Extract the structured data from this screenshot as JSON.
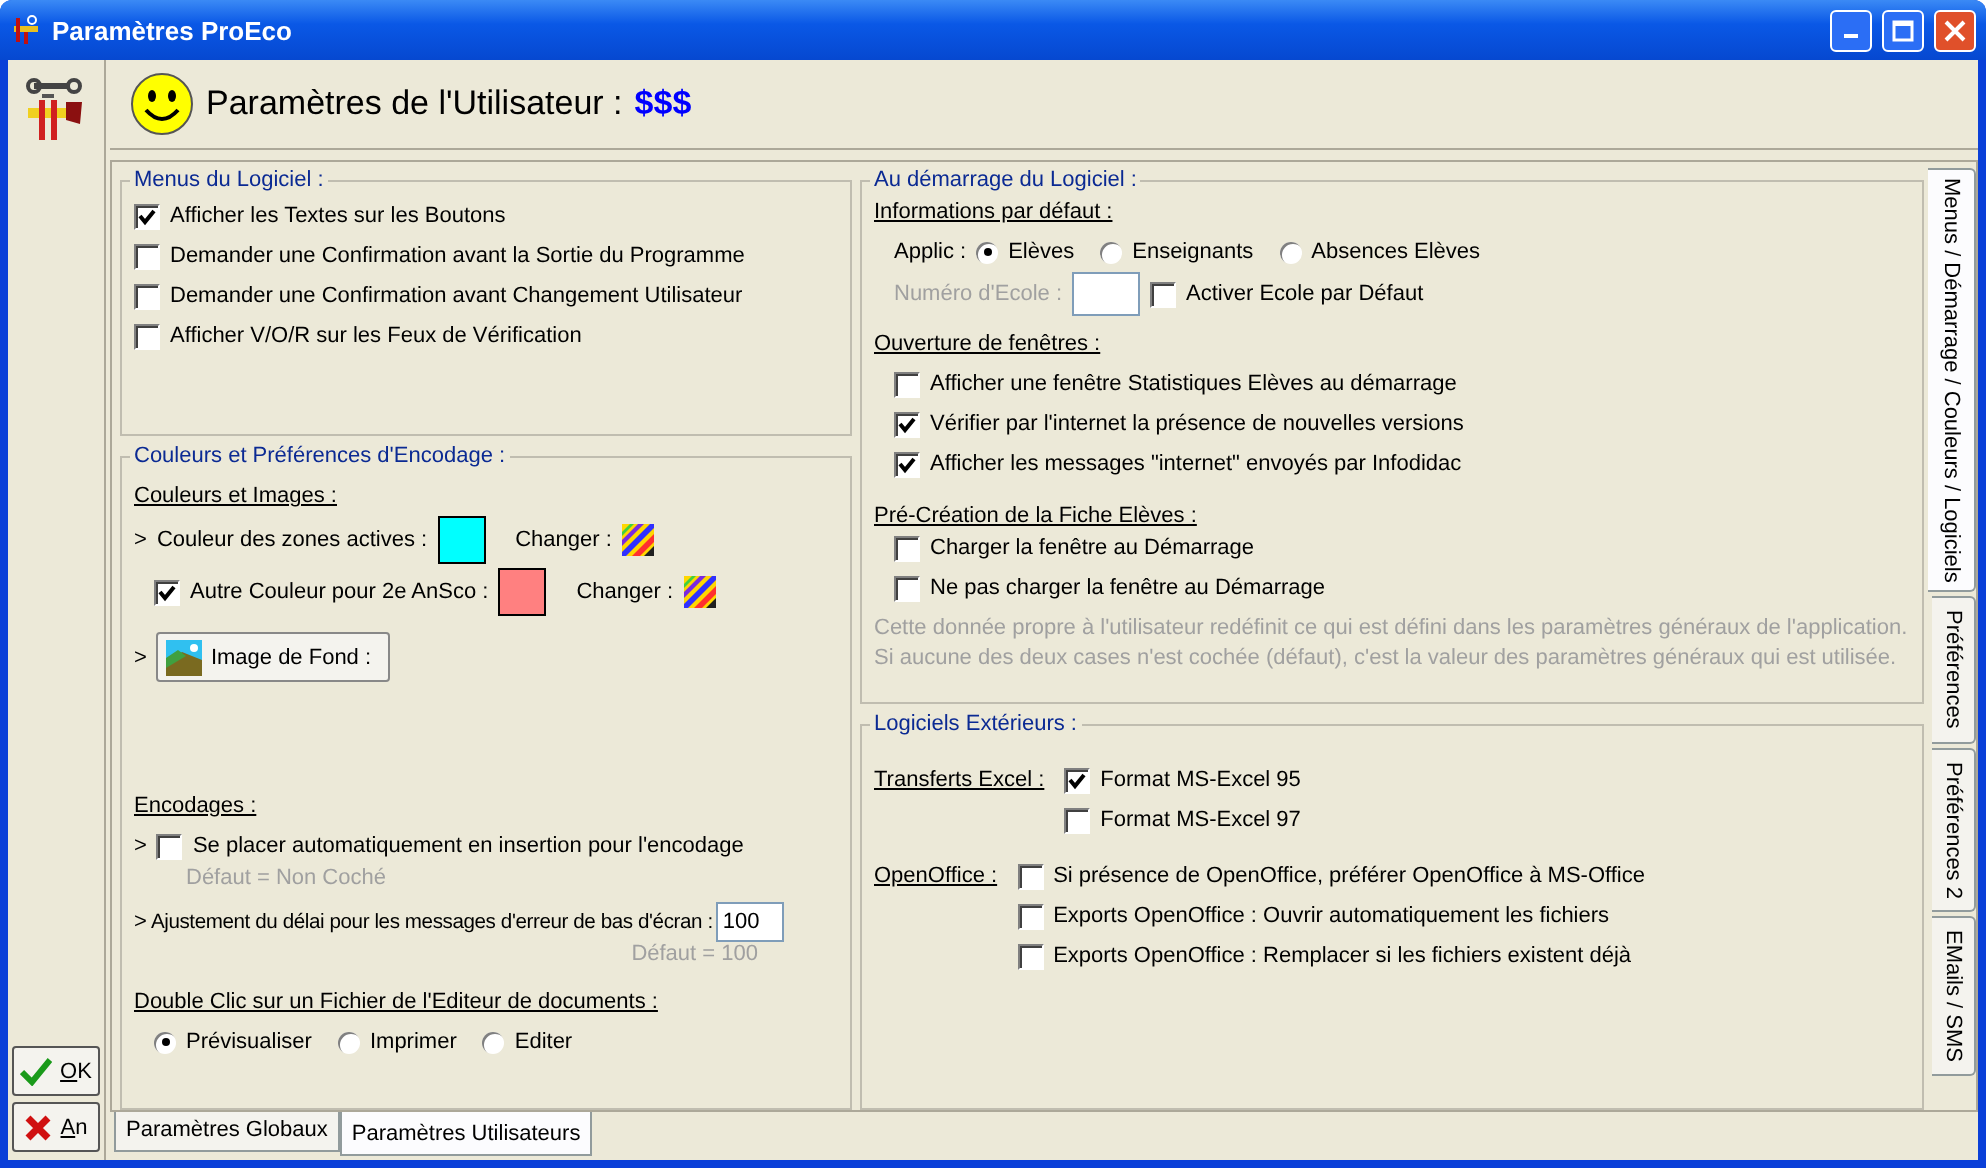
{
  "window": {
    "title": "Paramètres ProEco"
  },
  "header": {
    "title": "Paramètres de l'Utilisateur :",
    "user": "$$$"
  },
  "menus": {
    "legend": "Menus du Logiciel :",
    "options": [
      {
        "label": "Afficher les Textes sur les Boutons",
        "checked": true
      },
      {
        "label": "Demander une Confirmation avant la Sortie du Programme",
        "checked": false
      },
      {
        "label": "Demander une Confirmation avant Changement Utilisateur",
        "checked": false
      },
      {
        "label": "Afficher V/O/R sur les Feux de Vérification",
        "checked": false
      }
    ]
  },
  "colors": {
    "legend": "Couleurs et Préférences d'Encodage :",
    "heading": "Couleurs et Images :",
    "active_color": {
      "prefix": ">",
      "label": "Couleur des zones actives :",
      "color": "#00ffff",
      "change_label": "Changer :"
    },
    "alt_color": {
      "checked": true,
      "label": "Autre Couleur pour 2e AnSco :",
      "color": "#ff8080",
      "change_label": "Changer :"
    },
    "background_image": {
      "prefix": ">",
      "button": "Image de Fond :"
    },
    "encoding": {
      "heading": "Encodages :",
      "insert": {
        "prefix": ">",
        "label": "Se placer automatiquement en insertion pour l'encodage",
        "checked": false,
        "hint": "Défaut = Non Coché"
      },
      "delay": {
        "prefix": ">",
        "label": "Ajustement du délai pour les messages d'erreur de bas d'écran :",
        "value": "100",
        "hint": "Défaut = 100"
      }
    },
    "double_click": {
      "heading": "Double Clic sur un Fichier de l'Editeur de documents :",
      "options": [
        {
          "label": "Prévisualiser",
          "selected": true
        },
        {
          "label": "Imprimer",
          "selected": false
        },
        {
          "label": "Editer",
          "selected": false
        }
      ]
    }
  },
  "startup": {
    "legend": "Au démarrage du Logiciel :",
    "defaults": {
      "heading": "Informations par défaut :",
      "applic_label": "Applic :",
      "options": [
        {
          "label": "Elèves",
          "selected": true
        },
        {
          "label": "Enseignants",
          "selected": false
        },
        {
          "label": "Absences Elèves",
          "selected": false
        }
      ],
      "school": {
        "label": "Numéro d'Ecole :",
        "disabled": true
      },
      "activate": {
        "label": "Activer Ecole par Défaut",
        "checked": false
      }
    },
    "windows": {
      "heading": "Ouverture de fenêtres :",
      "options": [
        {
          "label": "Afficher une fenêtre Statistiques Elèves au démarrage",
          "checked": false
        },
        {
          "label": "Vérifier par l'internet la présence de nouvelles versions",
          "checked": true
        },
        {
          "label": "Afficher les messages \"internet\" envoyés par Infodidac",
          "checked": true
        }
      ]
    },
    "precreation": {
      "heading": "Pré-Création de la Fiche Elèves :",
      "options": [
        {
          "label": "Charger la fenêtre au Démarrage",
          "checked": false
        },
        {
          "label": "Ne pas charger la fenêtre au Démarrage",
          "checked": false
        }
      ],
      "note": "Cette donnée propre à l'utilisateur redéfinit ce qui est défini dans les paramètres généraux de l'application. Si aucune des deux cases n'est cochée (défaut), c'est la valeur des paramètres généraux qui est utilisée."
    }
  },
  "external": {
    "legend": "Logiciels Extérieurs :",
    "excel": {
      "heading": "Transferts Excel :",
      "options": [
        {
          "label": "Format MS-Excel 95",
          "checked": true
        },
        {
          "label": "Format MS-Excel 97",
          "checked": false
        }
      ]
    },
    "openoffice": {
      "heading": "OpenOffice :",
      "options": [
        {
          "label": "Si présence de OpenOffice, préférer OpenOffice à MS-Office",
          "checked": false
        },
        {
          "label": "Exports OpenOffice : Ouvrir automatiquement les fichiers",
          "checked": false
        },
        {
          "label": "Exports OpenOffice  : Remplacer si les fichiers existent déjà",
          "checked": false
        }
      ]
    }
  },
  "side_tabs": [
    {
      "label": "Menus / Démarrage / Couleurs / Logiciels",
      "selected": true
    },
    {
      "label": "Préférences",
      "selected": false
    },
    {
      "label": "Préférences 2",
      "selected": false
    },
    {
      "label": "EMails / SMS",
      "selected": false
    }
  ],
  "buttons": [
    {
      "label": "OK",
      "kind": "ok"
    },
    {
      "label": "An",
      "kind": "cancel"
    }
  ],
  "bottom_tabs": [
    {
      "label": "Paramètres Globaux",
      "selected": false
    },
    {
      "label": "Paramètres Utilisateurs",
      "selected": true
    }
  ]
}
